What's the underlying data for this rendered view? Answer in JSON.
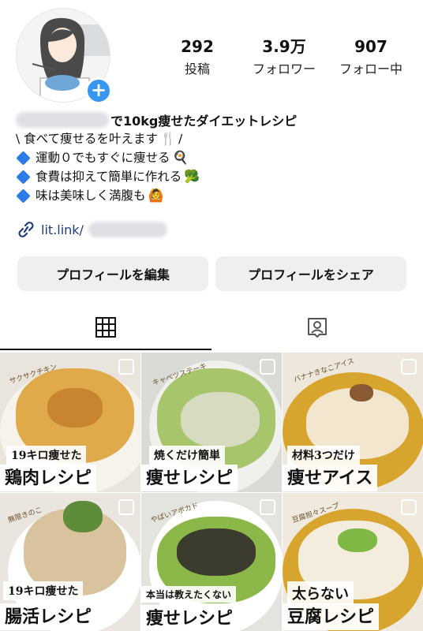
{
  "profile": {
    "stats": [
      {
        "value": "292",
        "label": "投稿"
      },
      {
        "value": "3.9万",
        "label": "フォロワー"
      },
      {
        "value": "907",
        "label": "フォロー中"
      }
    ],
    "bio_name_suffix": "で10kg痩せたダイエットレシピ",
    "bio_lines": [
      "\\ 食べて痩せるを叶えます",
      "運動０でもすぐに痩せる",
      "食費は抑えて簡単に作れる",
      "味は美味しく満腹も"
    ],
    "link_text": "lit.link/",
    "add_icon": "+"
  },
  "buttons": {
    "edit_profile": "プロフィールを編集",
    "share_profile": "プロフィールをシェア"
  },
  "tabs": [
    "grid-icon",
    "tagged-icon"
  ],
  "posts": [
    {
      "top": "サクサクチキン",
      "sub": "19キロ痩せた",
      "main": "鶏肉レシピ"
    },
    {
      "top": "キャベツステーキ",
      "sub": "焼くだけ簡単",
      "main": "痩せレシピ"
    },
    {
      "top": "バナナきなこアイス",
      "sub": "材料3つだけ",
      "main": "痩せアイス"
    },
    {
      "top": "無限きのこ",
      "sub": "19キロ痩せた",
      "main": "腸活レシピ"
    },
    {
      "top": "やばいアボカド",
      "sub": "本当は教えたくない",
      "main": "痩せレシピ"
    },
    {
      "top": "豆腐担々スープ",
      "sub": "太らない",
      "main": "豆腐レシピ"
    }
  ],
  "colors": {
    "accent": "#3797f0",
    "link": "#1d3d7a",
    "button_bg": "#efefef",
    "diamond": "#2f7be5"
  }
}
